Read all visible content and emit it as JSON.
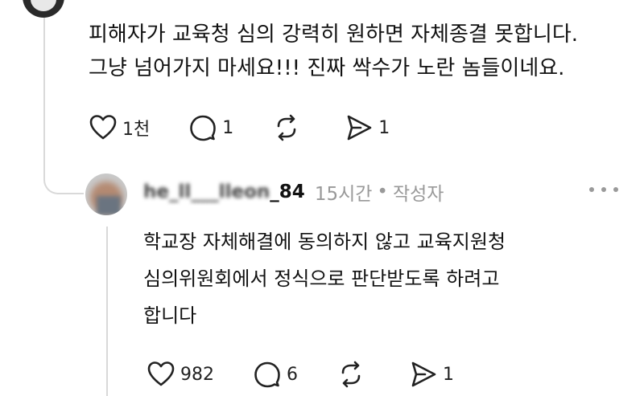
{
  "comment": {
    "lines": [
      "피해자가 교육청 심의 강력히 원하면 자체종결 못합니다.",
      "그냥 넘어가지 마세요!!! 진짜 싹수가 노란 놈들이네요."
    ],
    "actions": {
      "like_count": "1천",
      "reply_count": "1",
      "repost_count": "",
      "share_count": "1"
    }
  },
  "reply": {
    "username_masked": "he_ll___lleon",
    "username_visible": "_84",
    "time": "15시간",
    "separator": "•",
    "author_label": "작성자",
    "lines": [
      "학교장 자체해결에 동의하지 않고 교육지원청",
      "심의위원회에서 정식으로 판단받도록 하려고",
      "합니다"
    ],
    "actions": {
      "like_count": "982",
      "reply_count": "6",
      "repost_count": "",
      "share_count": "1"
    }
  },
  "icons": {
    "like": "heart-icon",
    "reply": "comment-bubble-icon",
    "repost": "repost-arrows-icon",
    "share": "send-icon",
    "more": "more-dots-icon"
  }
}
